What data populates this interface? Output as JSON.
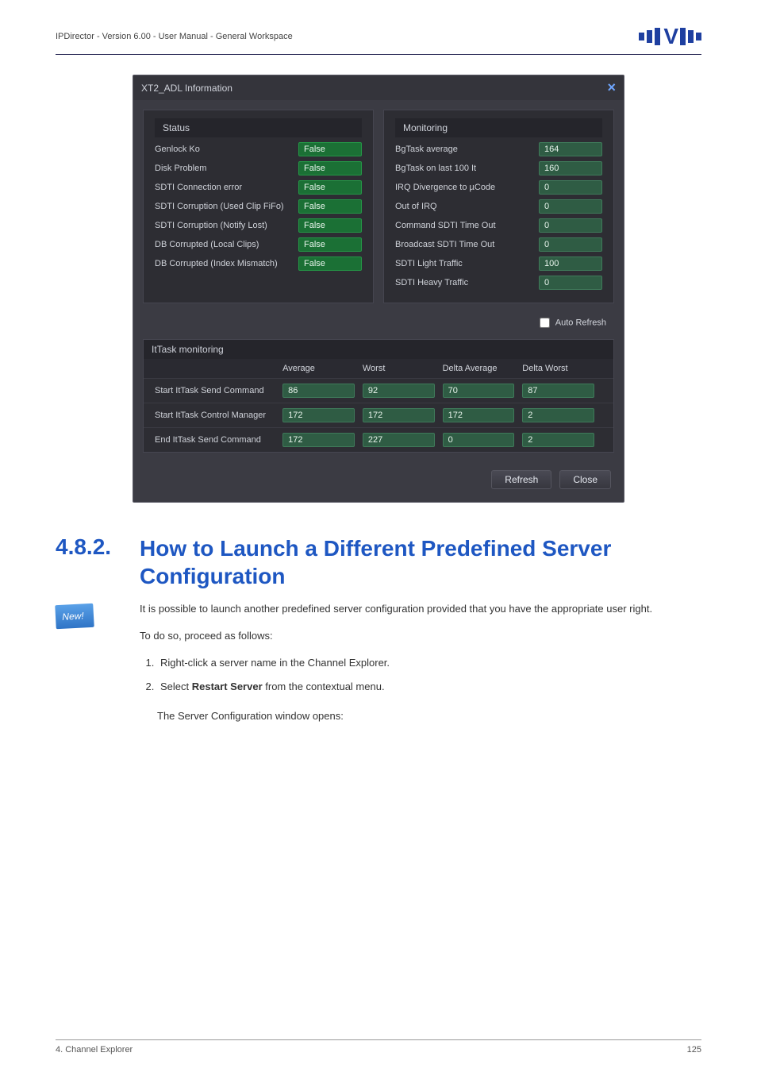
{
  "header": {
    "product_line": "IPDirector - Version 6.00 - User Manual - General Workspace"
  },
  "dialog": {
    "title": "XT2_ADL Information",
    "status_header": "Status",
    "monitoring_header": "Monitoring",
    "status_items": [
      {
        "label": "Genlock Ko",
        "value": "False"
      },
      {
        "label": "Disk Problem",
        "value": "False"
      },
      {
        "label": "SDTI Connection error",
        "value": "False"
      },
      {
        "label": "SDTI Corruption (Used Clip FiFo)",
        "value": "False"
      },
      {
        "label": "SDTI Corruption (Notify Lost)",
        "value": "False"
      },
      {
        "label": "DB Corrupted (Local Clips)",
        "value": "False"
      },
      {
        "label": "DB Corrupted (Index Mismatch)",
        "value": "False"
      }
    ],
    "monitoring_items": [
      {
        "label": "BgTask average",
        "value": "164"
      },
      {
        "label": "BgTask on last 100 It",
        "value": "160"
      },
      {
        "label": "IRQ Divergence to µCode",
        "value": "0"
      },
      {
        "label": "Out of IRQ",
        "value": "0"
      },
      {
        "label": "Command SDTI Time Out",
        "value": "0"
      },
      {
        "label": "Broadcast SDTI Time Out",
        "value": "0"
      },
      {
        "label": "SDTI Light Traffic",
        "value": "100"
      },
      {
        "label": "SDTI Heavy Traffic",
        "value": "0"
      }
    ],
    "auto_refresh_label": "Auto Refresh",
    "ittask_header": "ItTask monitoring",
    "ittask_columns": {
      "average": "Average",
      "worst": "Worst",
      "delta_average": "Delta Average",
      "delta_worst": "Delta Worst"
    },
    "ittask_rows": [
      {
        "name": "Start ItTask Send Command",
        "average": "86",
        "worst": "92",
        "delta_average": "70",
        "delta_worst": "87"
      },
      {
        "name": "Start ItTask Control Manager",
        "average": "172",
        "worst": "172",
        "delta_average": "172",
        "delta_worst": "2"
      },
      {
        "name": "End ItTask Send Command",
        "average": "172",
        "worst": "227",
        "delta_average": "0",
        "delta_worst": "2"
      }
    ],
    "refresh_btn": "Refresh",
    "close_btn": "Close"
  },
  "section": {
    "number": "4.8.2.",
    "title": "How to Launch a Different Predefined Server Configuration",
    "new_badge": "New!",
    "para1": "It is possible to launch another predefined server configuration provided that you have the appropriate user right.",
    "para2": "To do so, proceed as follows:",
    "step1": "Right-click a server name in the Channel Explorer.",
    "step2_prefix": "Select ",
    "step2_bold": "Restart Server",
    "step2_suffix": " from the contextual menu.",
    "para3": "The Server Configuration window opens:"
  },
  "footer": {
    "left": "4. Channel Explorer",
    "right": "125"
  }
}
